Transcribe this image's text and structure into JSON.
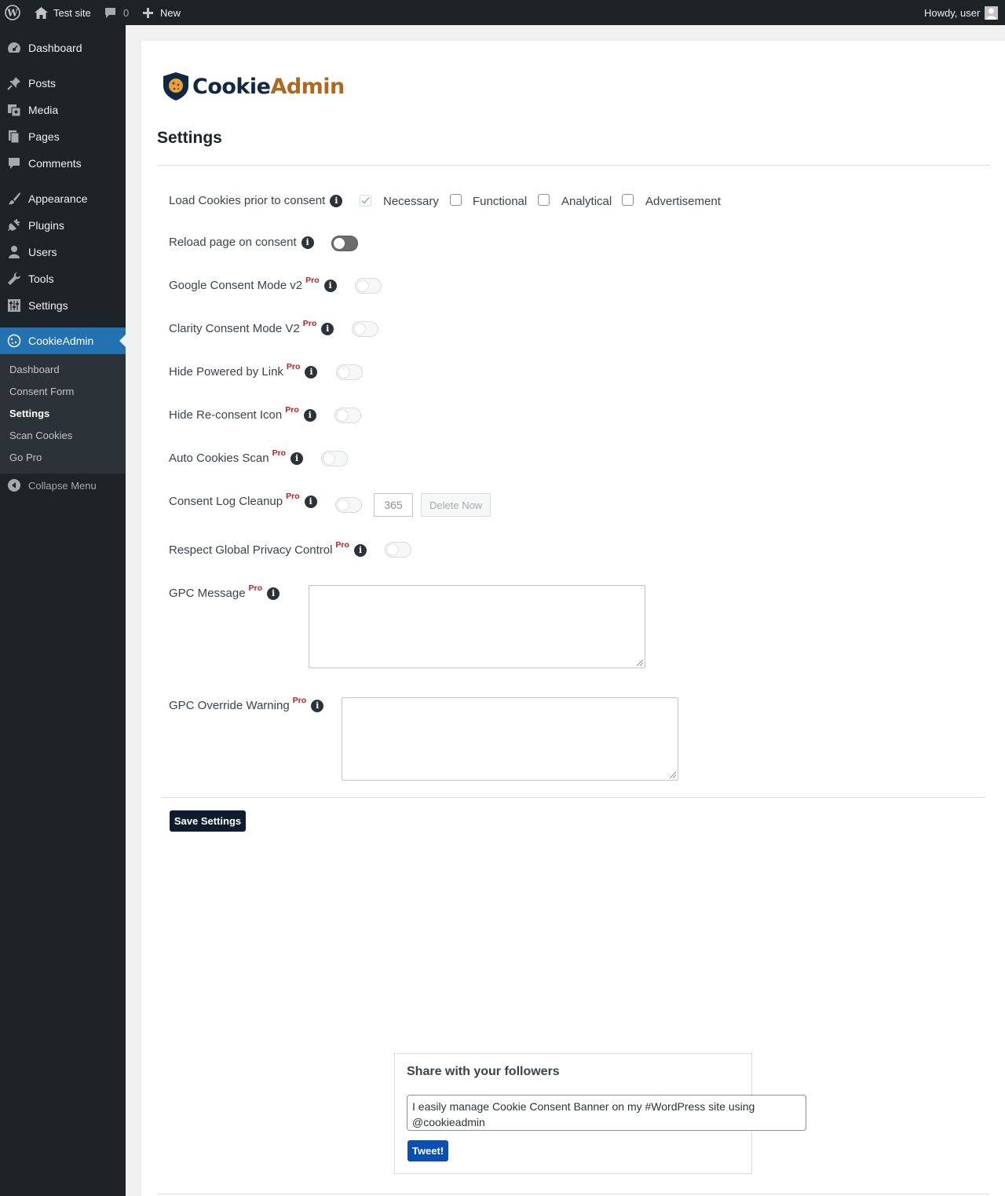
{
  "adminbar": {
    "site_name": "Test site",
    "comments_count": "0",
    "new_label": "New",
    "howdy": "Howdy, user"
  },
  "sidebar": {
    "items": [
      {
        "label": "Dashboard",
        "icon": "dashboard-icon"
      },
      {
        "label": "Posts",
        "icon": "pin-icon"
      },
      {
        "label": "Media",
        "icon": "media-icon"
      },
      {
        "label": "Pages",
        "icon": "pages-icon"
      },
      {
        "label": "Comments",
        "icon": "comment-icon"
      },
      {
        "label": "Appearance",
        "icon": "paintbrush-icon"
      },
      {
        "label": "Plugins",
        "icon": "plugin-icon"
      },
      {
        "label": "Users",
        "icon": "user-icon"
      },
      {
        "label": "Tools",
        "icon": "wrench-icon"
      },
      {
        "label": "Settings",
        "icon": "settings-icon"
      },
      {
        "label": "CookieAdmin",
        "icon": "cookie-icon"
      }
    ],
    "submenu": [
      "Dashboard",
      "Consent Form",
      "Settings",
      "Scan Cookies",
      "Go Pro"
    ],
    "collapse": "Collapse Menu"
  },
  "logo": {
    "part1": "Cookie",
    "part2": "Admin"
  },
  "page_title": "Settings",
  "rows": {
    "load_cookies": "Load Cookies prior to consent",
    "categories": [
      "Necessary",
      "Functional",
      "Analytical",
      "Advertisement"
    ],
    "reload": "Reload page on consent",
    "google": "Google Consent Mode v2",
    "clarity": "Clarity Consent Mode V2",
    "hide_powered": "Hide Powered by Link",
    "hide_reconsent": "Hide Re-consent Icon",
    "auto_scan": "Auto Cookies Scan",
    "log_cleanup": "Consent Log Cleanup",
    "log_days": "365",
    "delete_now": "Delete Now",
    "gpc": "Respect Global Privacy Control",
    "gpc_message": "GPC Message",
    "gpc_override": "GPC Override Warning",
    "pro": "Pro",
    "info": "i"
  },
  "save_label": "Save Settings",
  "share": {
    "title": "Share with your followers",
    "text": "I easily manage Cookie Consent Banner on my #WordPress site using @cookieadmin",
    "tweet": "Tweet!"
  }
}
